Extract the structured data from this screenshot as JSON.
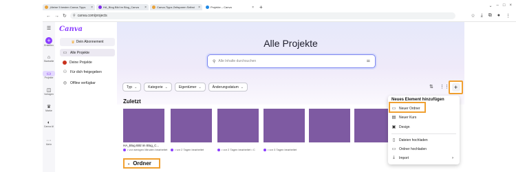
{
  "browser": {
    "tabs": [
      {
        "title": "„Meine 5 besten Canva-Tipps",
        "color": "#e8a23a",
        "active": false
      },
      {
        "title": "HA_Blog Bild im Blog_Canva",
        "color": "#7d2ae8",
        "active": false
      },
      {
        "title": "Canva-Tipps Zeitsparen Selbst",
        "color": "#e8a23a",
        "active": false
      },
      {
        "title": "Projekte – Canva",
        "color": "#1e88e5",
        "active": true
      }
    ],
    "new_tab": "+",
    "url": "canva.com/projects"
  },
  "rail": {
    "create_label": "Erstellen",
    "home_label": "Startseite",
    "projects_label": "Projekte",
    "templates_label": "Vorlagen",
    "brand_label": "Marke",
    "ai_label": "Canva AI",
    "more_label": "Mehr"
  },
  "sidebar": {
    "logo": "Canva",
    "subscription_label": "Dein Abonnement",
    "items": [
      {
        "label": "Alle Projekte"
      },
      {
        "label": "Deine Projekte"
      },
      {
        "label": "Für dich freigegeben"
      },
      {
        "label": "Offline verfügbar"
      }
    ]
  },
  "main": {
    "title": "Alle Projekte",
    "search_placeholder": "Alle Inhalte durchsuchen",
    "filters": [
      "Typ",
      "Kategorie",
      "Eigentümer",
      "Änderungsdatum"
    ],
    "recent_heading": "Zuletzt",
    "recent_items": [
      {
        "caption": "HA_Blog Bild im Blog_C...",
        "meta": "• vor wenigen Minuten bearbeitet"
      },
      {
        "caption": "",
        "meta": "• vor 2 Tagen bearbeitet"
      },
      {
        "caption": "",
        "meta": "• vor 2 Tagen bearbeitet • C"
      },
      {
        "caption": "",
        "meta": "• vor 3 Tagen bearbeitet"
      },
      {
        "caption": "",
        "meta": ""
      },
      {
        "caption": "",
        "meta": ""
      }
    ],
    "folders_heading": "Ordner"
  },
  "add_button": "+",
  "menu": {
    "title": "Neues Element hinzufügen",
    "items": [
      "Neuer Ordner",
      "Neuer Kurs",
      "Design",
      "Dateien hochladen",
      "Ordner hochladen",
      "Import"
    ]
  },
  "colors": {
    "accent": "#8b3dff",
    "highlight": "#f0a030",
    "thumbnail": "#7e5aa2"
  }
}
